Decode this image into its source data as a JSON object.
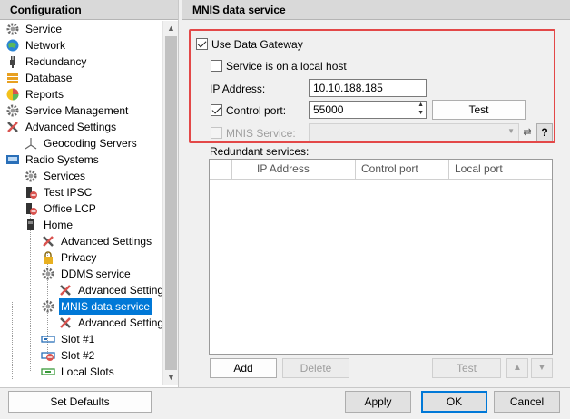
{
  "left_panel": {
    "title": "Configuration",
    "tree": [
      {
        "label": "Service",
        "icon": "gear-icon"
      },
      {
        "label": "Network",
        "icon": "network-globe-icon"
      },
      {
        "label": "Redundancy",
        "icon": "plug-icon"
      },
      {
        "label": "Database",
        "icon": "database-icon"
      },
      {
        "label": "Reports",
        "icon": "reports-icon"
      },
      {
        "label": "Service Management",
        "icon": "gear-icon"
      },
      {
        "label": "Advanced Settings",
        "icon": "tools-icon"
      },
      {
        "label": "Geocoding Servers",
        "icon": "geocoding-icon"
      },
      {
        "label": "Radio Systems",
        "icon": "radio-systems-icon"
      },
      {
        "label": "Services",
        "icon": "gear-icon"
      },
      {
        "label": "Test IPSC",
        "icon": "radio-error-icon"
      },
      {
        "label": "Office LCP",
        "icon": "radio-error-icon"
      },
      {
        "label": "Home",
        "icon": "radio-icon"
      },
      {
        "label": "Advanced Settings",
        "icon": "tools-icon"
      },
      {
        "label": "Privacy",
        "icon": "lock-icon"
      },
      {
        "label": "DDMS service",
        "icon": "gear-icon"
      },
      {
        "label": "Advanced Settings",
        "icon": "tools-icon"
      },
      {
        "label": "MNIS data service",
        "icon": "gear-icon"
      },
      {
        "label": "Advanced Settings",
        "icon": "tools-icon"
      },
      {
        "label": "Slot #1",
        "icon": "slot-icon"
      },
      {
        "label": "Slot #2",
        "icon": "slot-error-icon"
      },
      {
        "label": "Local Slots",
        "icon": "local-slots-icon"
      }
    ]
  },
  "right_panel": {
    "title": "MNIS data service",
    "use_data_gateway": {
      "label": "Use Data Gateway",
      "checked": true
    },
    "local_host": {
      "label": "Service is on a local host",
      "checked": false
    },
    "ip_address": {
      "label": "IP Address:",
      "value": "10.10.188.185"
    },
    "control_port": {
      "label": "Control port:",
      "value": "55000",
      "checked": true
    },
    "test_button": "Test",
    "mnis_service": {
      "label": "MNIS Service:",
      "value": "",
      "help": "?"
    },
    "redundant": {
      "label": "Redundant services:",
      "columns": [
        "IP Address",
        "Control port",
        "Local port"
      ],
      "rows": []
    },
    "buttons": {
      "add": "Add",
      "delete": "Delete",
      "test": "Test",
      "up": "▲",
      "down": "▼"
    }
  },
  "footer": {
    "set_defaults": "Set Defaults",
    "apply": "Apply",
    "ok": "OK",
    "cancel": "Cancel"
  },
  "colors": {
    "accent": "#0078d7",
    "highlight": "#e34848"
  }
}
